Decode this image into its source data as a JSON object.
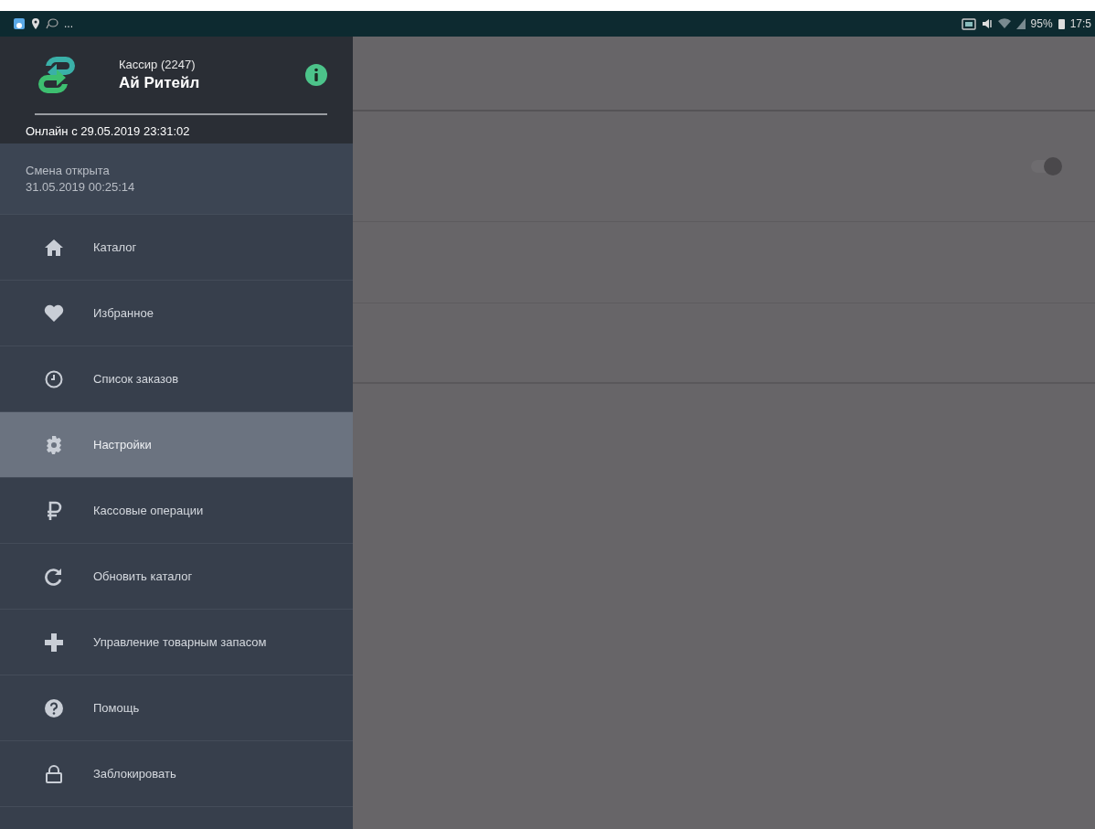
{
  "status_bar": {
    "overflow": "...",
    "battery": "95%",
    "time": "17:5"
  },
  "drawer": {
    "role": "Кассир (2247)",
    "store": "Ай Ритейл",
    "online": "Онлайн с 29.05.2019 23:31:02",
    "shift_status": "Смена открыта",
    "shift_time": "31.05.2019 00:25:14",
    "items": [
      {
        "label": "Каталог",
        "selected": false
      },
      {
        "label": "Избранное",
        "selected": false
      },
      {
        "label": "Список заказов",
        "selected": false
      },
      {
        "label": "Настройки",
        "selected": true
      },
      {
        "label": "Кассовые операции",
        "selected": false
      },
      {
        "label": "Обновить каталог",
        "selected": false
      },
      {
        "label": "Управление товарным запасом",
        "selected": false
      },
      {
        "label": "Помощь",
        "selected": false
      },
      {
        "label": "Заблокировать",
        "selected": false
      }
    ]
  },
  "settings": {
    "switch": {
      "on": true
    }
  }
}
